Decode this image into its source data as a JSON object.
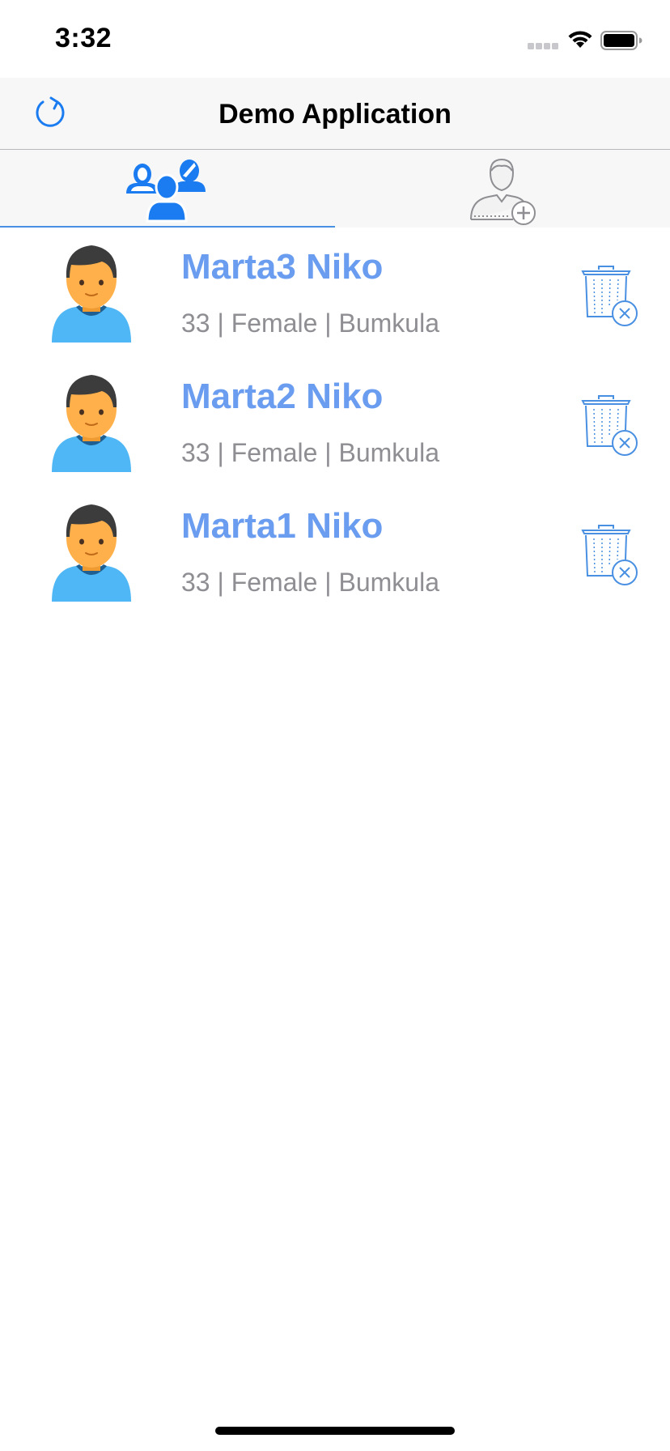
{
  "status_bar": {
    "time": "3:32"
  },
  "nav": {
    "title": "Demo Application",
    "refresh_icon": "refresh-icon"
  },
  "tabs": [
    {
      "icon": "users-group-icon",
      "selected": true
    },
    {
      "icon": "add-user-icon",
      "selected": false
    }
  ],
  "users": [
    {
      "name": "Marta3 Niko",
      "details": "33 | Female | Bumkula"
    },
    {
      "name": "Marta2 Niko",
      "details": "33 | Female | Bumkula"
    },
    {
      "name": "Marta1 Niko",
      "details": "33 | Female | Bumkula"
    }
  ],
  "colors": {
    "accent": "#4a90e2",
    "name_text": "#6a9cf0",
    "detail_text": "#8e8e93",
    "nav_background": "#f7f7f7",
    "avatar_skin": "#ffb04a",
    "avatar_shirt": "#4fb7f5",
    "avatar_hair": "#3c3c3c"
  }
}
